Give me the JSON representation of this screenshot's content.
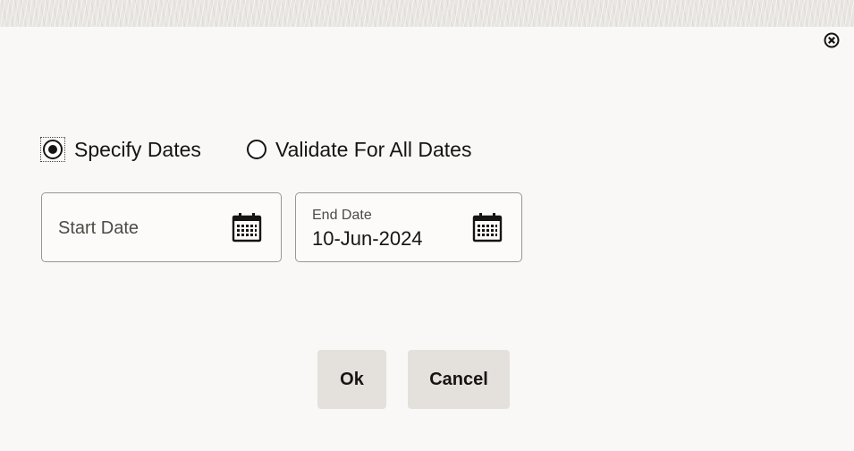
{
  "dialog": {
    "close_icon": "close-circle-icon",
    "radio_options": [
      {
        "label": "Specify Dates",
        "checked": true
      },
      {
        "label": "Validate For All Dates",
        "checked": false
      }
    ],
    "start_date": {
      "label": "Start Date",
      "value": "",
      "icon": "calendar-icon"
    },
    "end_date": {
      "label": "End Date",
      "value": "10-Jun-2024",
      "icon": "calendar-icon"
    },
    "buttons": {
      "ok_label": "Ok",
      "cancel_label": "Cancel"
    }
  }
}
